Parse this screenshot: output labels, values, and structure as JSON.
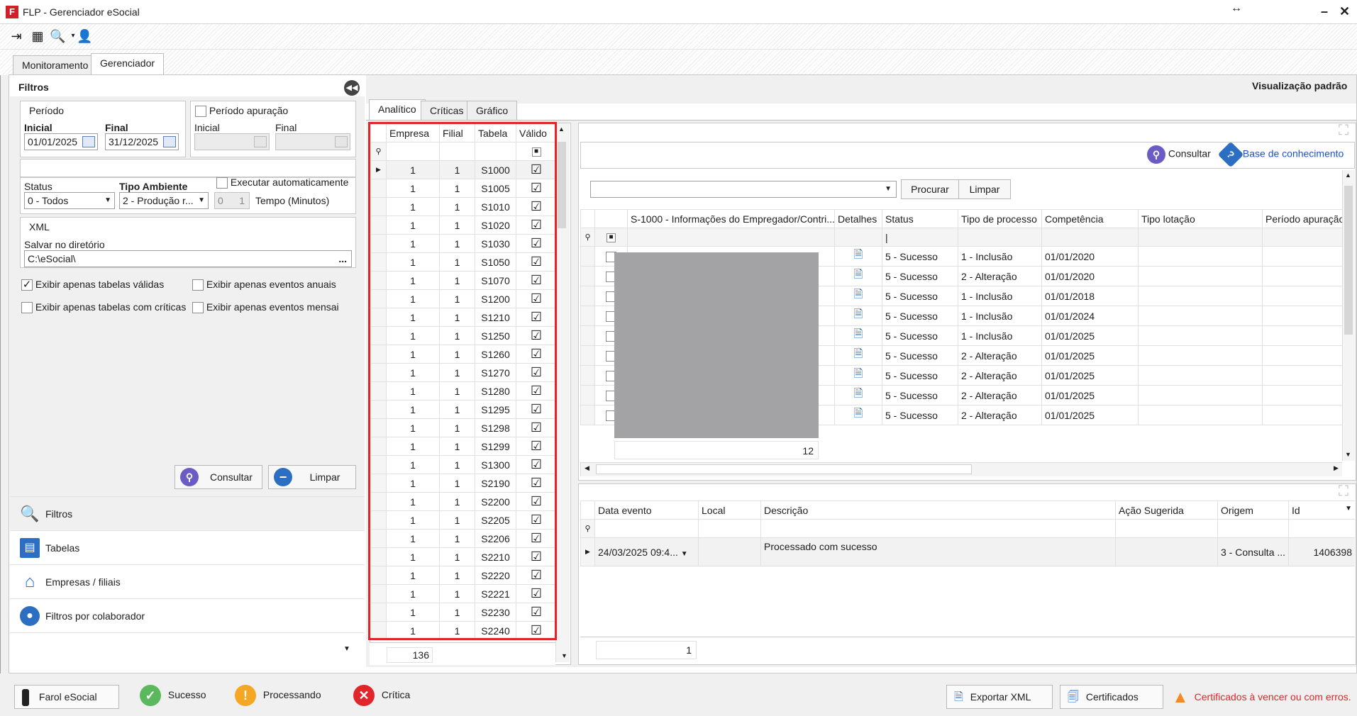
{
  "window": {
    "title": "FLP - Gerenciador eSocial",
    "app_icon": "F",
    "minimize": "–",
    "close": "✕",
    "resize_glyph": "↔"
  },
  "toolbar": {
    "icons": [
      "exit-icon",
      "message-icon",
      "search-dropdown-icon",
      "user-icon"
    ]
  },
  "tabs": {
    "monitoramento": "Monitoramento",
    "gerenciador": "Gerenciador"
  },
  "filters": {
    "title": "Filtros",
    "periodo_label": "Período",
    "inicial_label": "Inicial",
    "final_label": "Final",
    "inicial_value": "01/01/2025",
    "final_value": "31/12/2025",
    "periodo_apuracao_label": "Período apuração",
    "apuracao_inicial_label": "Inicial",
    "apuracao_final_label": "Final",
    "status_label": "Status",
    "status_value": "0 - Todos",
    "tipo_ambiente_label": "Tipo Ambiente",
    "tipo_ambiente_value": "2 - Produção r...",
    "executar_label": "Executar automaticamente",
    "tempo_value": "0",
    "tempo_unit": "1",
    "tempo_label": "Tempo (Minutos)",
    "xml_label": "XML",
    "salvar_label": "Salvar no diretório",
    "salvar_value": "C:\\eSocial\\",
    "browse": "...",
    "exibir_validas": "Exibir apenas tabelas válidas",
    "exibir_anuais": "Exibir apenas eventos anuais",
    "exibir_criticas": "Exibir apenas tabelas com críticas",
    "exibir_mensais": "Exibir apenas eventos mensai",
    "consultar": "Consultar",
    "limpar": "Limpar"
  },
  "nav": {
    "filtros": "Filtros",
    "tabelas": "Tabelas",
    "empresas": "Empresas / filiais",
    "colaborador": "Filtros por colaborador"
  },
  "view_title": "Visualização padrão",
  "sub_tabs": {
    "analitico": "Analítico",
    "criticas": "Críticas",
    "grafico": "Gráfico"
  },
  "left_grid": {
    "headers": [
      "Empresa",
      "Filial",
      "Tabela",
      "Válido"
    ],
    "rows": [
      [
        "1",
        "1",
        "S1000"
      ],
      [
        "1",
        "1",
        "S1005"
      ],
      [
        "1",
        "1",
        "S1010"
      ],
      [
        "1",
        "1",
        "S1020"
      ],
      [
        "1",
        "1",
        "S1030"
      ],
      [
        "1",
        "1",
        "S1050"
      ],
      [
        "1",
        "1",
        "S1070"
      ],
      [
        "1",
        "1",
        "S1200"
      ],
      [
        "1",
        "1",
        "S1210"
      ],
      [
        "1",
        "1",
        "S1250"
      ],
      [
        "1",
        "1",
        "S1260"
      ],
      [
        "1",
        "1",
        "S1270"
      ],
      [
        "1",
        "1",
        "S1280"
      ],
      [
        "1",
        "1",
        "S1295"
      ],
      [
        "1",
        "1",
        "S1298"
      ],
      [
        "1",
        "1",
        "S1299"
      ],
      [
        "1",
        "1",
        "S1300"
      ],
      [
        "1",
        "1",
        "S2190"
      ],
      [
        "1",
        "1",
        "S2200"
      ],
      [
        "1",
        "1",
        "S2205"
      ],
      [
        "1",
        "1",
        "S2206"
      ],
      [
        "1",
        "1",
        "S2210"
      ],
      [
        "1",
        "1",
        "S2220"
      ],
      [
        "1",
        "1",
        "S2221"
      ],
      [
        "1",
        "1",
        "S2230"
      ],
      [
        "1",
        "1",
        "S2240"
      ]
    ],
    "footer_count": "136"
  },
  "right_top": {
    "consultar": "Consultar",
    "base_conhecimento": "Base de conhecimento",
    "procurar": "Procurar",
    "limpar": "Limpar",
    "headers": [
      "S-1000 - Informações do Empregador/Contri...",
      "Detalhes",
      "Status",
      "Tipo de processo",
      "Competência",
      "Tipo lotação",
      "Período apuração"
    ],
    "rows": [
      [
        "5 - Sucesso",
        "1 - Inclusão",
        "01/01/2020"
      ],
      [
        "5 - Sucesso",
        "2 - Alteração",
        "01/01/2020"
      ],
      [
        "5 - Sucesso",
        "1 - Inclusão",
        "01/01/2018"
      ],
      [
        "5 - Sucesso",
        "1 - Inclusão",
        "01/01/2024"
      ],
      [
        "5 - Sucesso",
        "1 - Inclusão",
        "01/01/2025"
      ],
      [
        "5 - Sucesso",
        "2 - Alteração",
        "01/01/2025"
      ],
      [
        "5 - Sucesso",
        "2 - Alteração",
        "01/01/2025"
      ],
      [
        "5 - Sucesso",
        "2 - Alteração",
        "01/01/2025"
      ],
      [
        "5 - Sucesso",
        "2 - Alteração",
        "01/01/2025"
      ]
    ],
    "footer_count": "12"
  },
  "right_bottom": {
    "headers": [
      "Data evento",
      "Local",
      "Descrição",
      "Ação Sugerida",
      "Origem",
      "Id"
    ],
    "row": {
      "data": "24/03/2025 09:4...",
      "local": "",
      "descricao": "Processado com sucesso",
      "acao": "",
      "origem": "3 - Consulta ...",
      "id": "1406398"
    },
    "footer_count": "1"
  },
  "statusbar": {
    "farol": "Farol eSocial",
    "sucesso": "Sucesso",
    "processando": "Processando",
    "critica": "Crítica",
    "exportar": "Exportar XML",
    "certificados": "Certificados",
    "warning": "Certificados à vencer ou com erros."
  },
  "colors": {
    "accent": "#2c6fc2",
    "error": "#e0252b",
    "success": "#4caf50",
    "warning": "#f5a623"
  }
}
